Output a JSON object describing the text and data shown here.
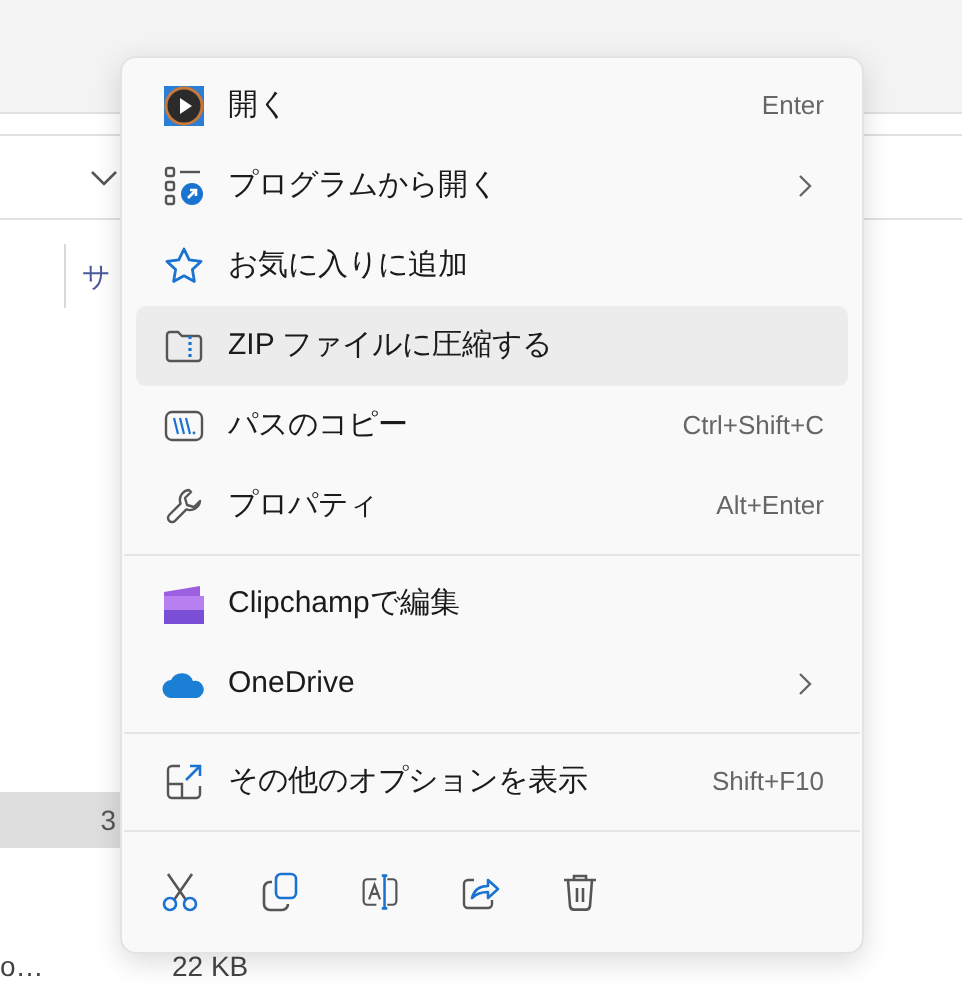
{
  "background": {
    "column_header": "サ",
    "row_cell": "3",
    "file_name": "o…",
    "file_size": "22 KB"
  },
  "menu": {
    "groups": [
      [
        {
          "label": "開く",
          "shortcut": "Enter",
          "has_submenu": false,
          "selected": false
        },
        {
          "label": "プログラムから開く",
          "has_submenu": true,
          "selected": false
        },
        {
          "label": "お気に入りに追加",
          "has_submenu": false,
          "selected": false
        },
        {
          "label": "ZIP ファイルに圧縮する",
          "has_submenu": false,
          "selected": true
        },
        {
          "label": "パスのコピー",
          "shortcut": "Ctrl+Shift+C",
          "has_submenu": false,
          "selected": false
        },
        {
          "label": "プロパティ",
          "shortcut": "Alt+Enter",
          "has_submenu": false,
          "selected": false
        }
      ],
      [
        {
          "label": "Clipchampで編集",
          "has_submenu": false,
          "selected": false
        },
        {
          "label": "OneDrive",
          "has_submenu": true,
          "selected": false
        }
      ],
      [
        {
          "label": "その他のオプションを表示",
          "shortcut": "Shift+F10",
          "has_submenu": false,
          "selected": false
        }
      ]
    ],
    "actions": [
      {
        "kind": "cut"
      },
      {
        "kind": "copy"
      },
      {
        "kind": "rename"
      },
      {
        "kind": "share"
      },
      {
        "kind": "delete"
      }
    ]
  }
}
